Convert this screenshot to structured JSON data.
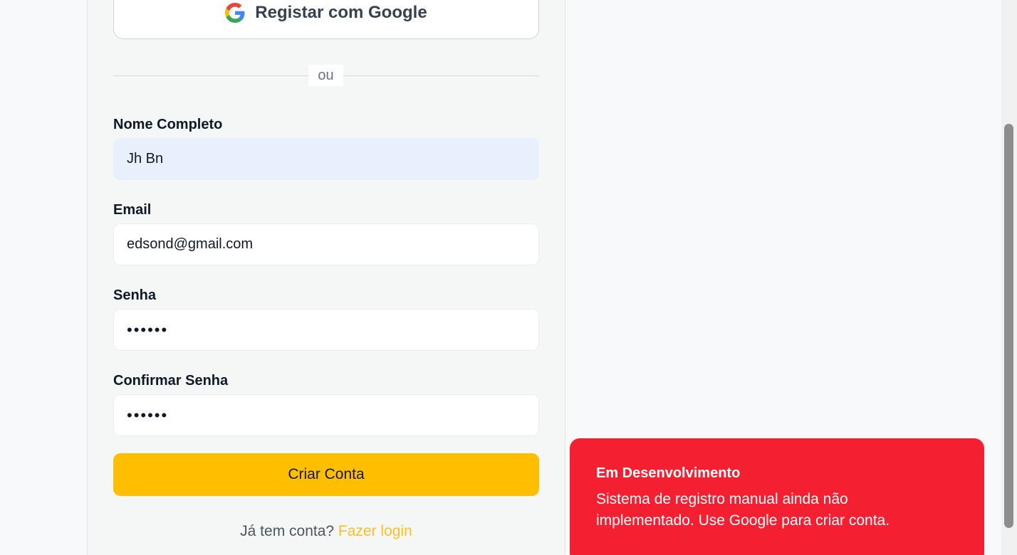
{
  "google_button": {
    "label": "Registar com Google",
    "icon": "google-g-icon"
  },
  "divider": {
    "text": "ou"
  },
  "fields": {
    "name": {
      "label": "Nome Completo",
      "value": "Jh Bn"
    },
    "email": {
      "label": "Email",
      "value": "edsond@gmail.com"
    },
    "password": {
      "label": "Senha",
      "value": "••••••"
    },
    "confirm": {
      "label": "Confirmar Senha",
      "value": "••••••"
    }
  },
  "submit": {
    "label": "Criar Conta"
  },
  "login_prompt": {
    "text": "Já tem conta?",
    "link": "Fazer login"
  },
  "toast": {
    "title": "Em Desenvolvimento",
    "message": "Sistema de registro manual ainda não implementado. Use Google para criar conta."
  },
  "colors": {
    "accent": "#ffbf00",
    "link": "#fbbf24",
    "toast_bg": "#f42032",
    "autofill_bg": "#e8f0fe"
  }
}
